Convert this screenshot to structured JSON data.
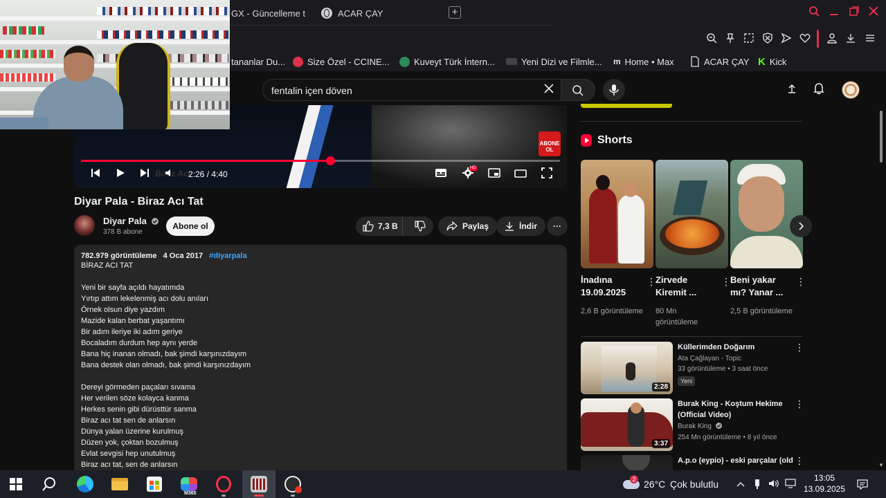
{
  "browser": {
    "tabs": [
      {
        "label": "GX - Güncelleme t"
      },
      {
        "label": "ACAR ÇAY"
      }
    ],
    "new_tab": "+",
    "bookmarks": [
      {
        "label": "tananlar Du...",
        "color": "#1a1a1f"
      },
      {
        "label": "Size Özel - CCINE...",
        "color": "#e0314a"
      },
      {
        "label": "Kuveyt Türk İntern...",
        "color": "#2e8b57"
      },
      {
        "label": "Yeni Dizi ve Filmle...",
        "color": "#444444"
      },
      {
        "label": "Home • Max",
        "color": "#1a1a1f"
      },
      {
        "label": "ACAR ÇAY",
        "color": "#1a1a1f"
      },
      {
        "label": "Kick",
        "color": "#53fc18"
      }
    ]
  },
  "youtube": {
    "search": {
      "value": "fentalin içen döven"
    },
    "player": {
      "time": "2:26 / 4:40",
      "progress_fraction": 0.52,
      "overlay_text": "Biraz Acı",
      "badge": "ABONE OL",
      "hd": "HD"
    },
    "video": {
      "title": "Diyar Pala - Biraz Acı Tat",
      "channel": "Diyar Pala",
      "subscribers": "378 B abone",
      "subscribe_label": "Abone ol",
      "likes": "7,3 B",
      "share_label": "Paylaş",
      "download_label": "İndir",
      "more": "···"
    },
    "description": {
      "views": "782.979 görüntüleme",
      "date": "4 Oca 2017",
      "hashtag": "#diyarpala",
      "lines": [
        "BİRAZ ACI TAT",
        "",
        "Yeni bir sayfa açıldı hayatımda",
        "Yırtıp attım lekelenmiş acı dolu anıları",
        "Örnek olsun diye yazdım",
        "Mazide kalan berbat yaşantımı",
        "Bir adım ileriye iki adım geriye",
        "Bocaladım durdum hep aynı yerde",
        "Bana hiç inanan olmadı, bak şimdi karşınızdayım",
        "Bana destek olan olmadı, bak şimdi karşınızdayım",
        "",
        "Dereyi görmeden paçaları sıvama",
        "Her verilen söze kolayca kanma",
        "Herkes senin gibi dürüsttür sanma",
        "Biraz acı tat sen de anlarsın",
        "Dünya yalan üzerine kurulmuş",
        "Düzen yok, çoktan bozulmuş",
        "Evlat sevgisi hep unutulmuş",
        "Biraz acı tat, sen de anlarsın"
      ]
    },
    "shorts": {
      "heading": "Shorts",
      "items": [
        {
          "title": "İnadına 19.09.2025",
          "views": "2,6 B görüntüleme"
        },
        {
          "title": "Zirvede Kiremit ...",
          "views": "80 Mn görüntüleme"
        },
        {
          "title": "Beni yakar mı? Yanar ...",
          "views": "2,5 B görüntüleme"
        }
      ]
    },
    "recommended": [
      {
        "title": "Küllerimden Doğarım",
        "channel": "Ata Çağlayan - Topic",
        "meta": "33 görüntüleme • 3 saat önce",
        "duration": "2:28",
        "badge": "Yeni",
        "verified": false
      },
      {
        "title": "Burak King - Koştum Hekime (Official Video)",
        "channel": "Burak King",
        "meta": "254 Mn görüntüleme • 8 yıl önce",
        "duration": "3:37",
        "badge": "",
        "verified": true
      },
      {
        "title": "A.p.o (eypio) - eski parçalar (old",
        "channel": "",
        "meta": "",
        "duration": "",
        "badge": "",
        "verified": false
      }
    ]
  },
  "taskbar": {
    "weather_temp": "26°C",
    "weather_desc": "Çok bulutlu",
    "weather_badge": "2",
    "time": "13:05",
    "date": "13.09.2025",
    "m365_label": "M365"
  }
}
